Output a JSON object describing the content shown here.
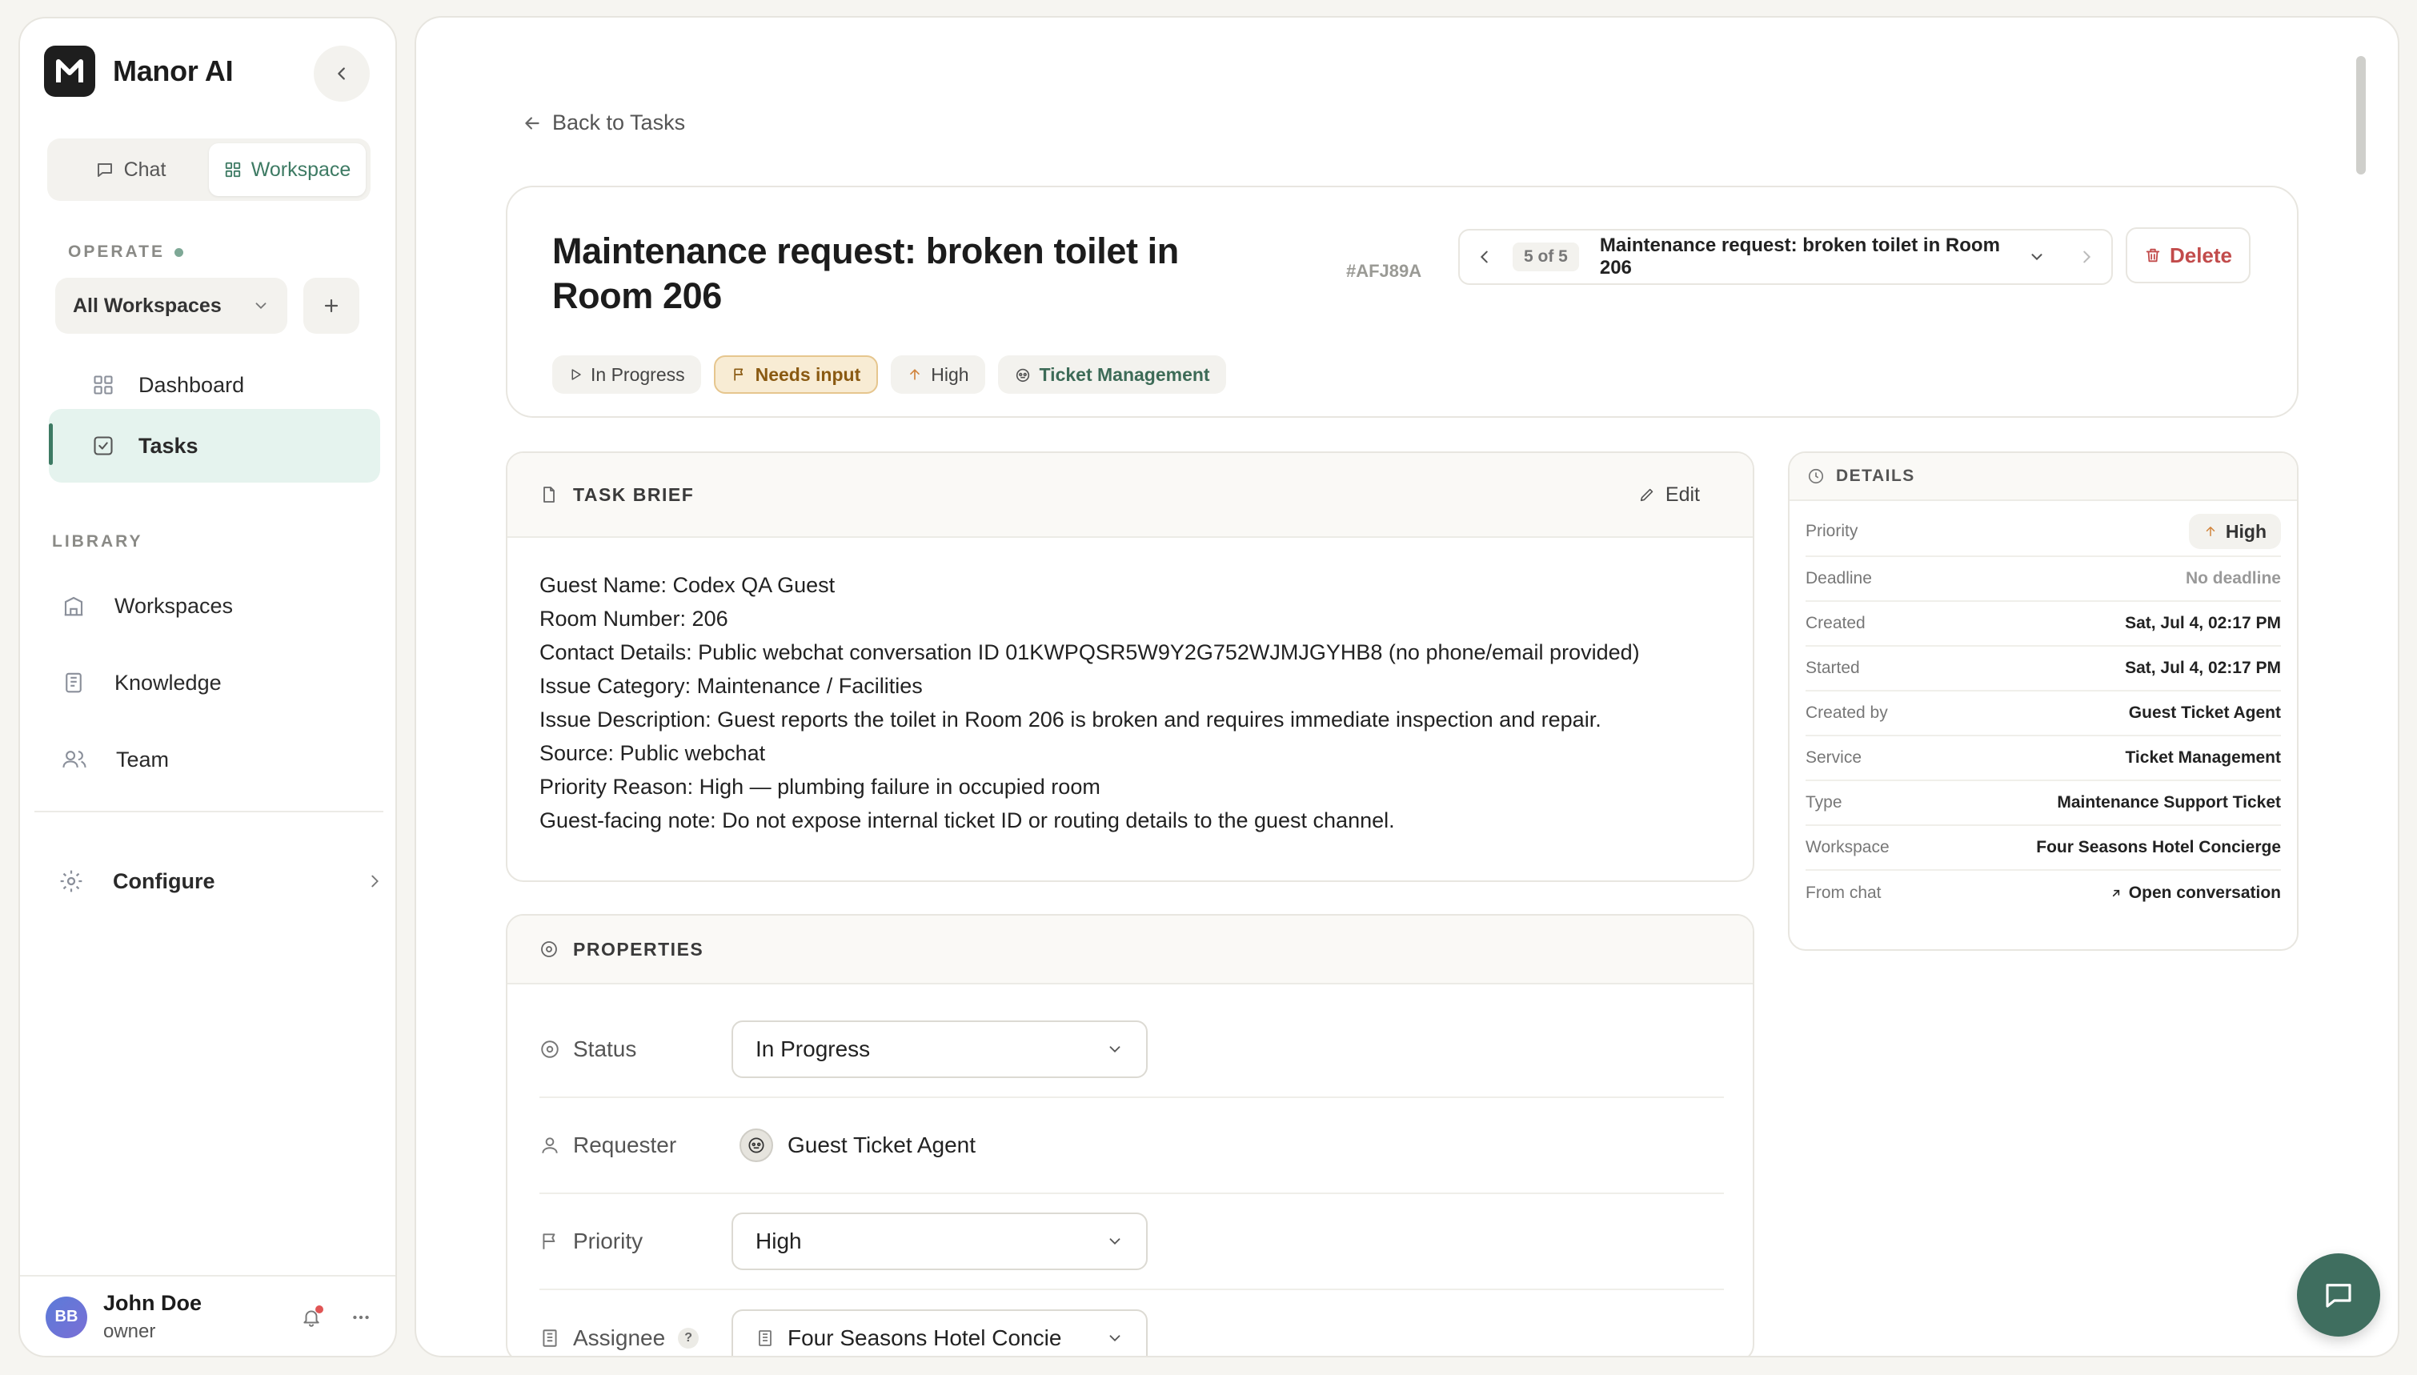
{
  "app": {
    "brand_name": "Manor AI",
    "accent_color": "#3d7a63"
  },
  "sidebar": {
    "modes": [
      {
        "label": "Chat",
        "icon": "chat-bubble-icon",
        "active": false
      },
      {
        "label": "Workspace",
        "icon": "grid-icon",
        "active": true
      }
    ],
    "operate_label": "OPERATE",
    "workspace_select": "All Workspaces",
    "nav": [
      {
        "label": "Dashboard",
        "icon": "dashboard-icon",
        "active": false
      },
      {
        "label": "Tasks",
        "icon": "checkbox-icon",
        "active": true
      }
    ],
    "library_label": "LIBRARY",
    "library": [
      {
        "label": "Workspaces",
        "icon": "building-icon"
      },
      {
        "label": "Knowledge",
        "icon": "book-icon"
      },
      {
        "label": "Team",
        "icon": "users-icon"
      }
    ],
    "configure_label": "Configure",
    "user": {
      "initials": "BB",
      "name": "John Doe",
      "role": "owner"
    }
  },
  "main": {
    "back_label": "Back to Tasks",
    "task": {
      "title": "Maintenance request: broken toilet in Room 206",
      "id": "#AFJ89A",
      "nav_count": "5 of 5",
      "nav_title": "Maintenance request: broken toilet in Room 206",
      "delete_label": "Delete",
      "badges": [
        {
          "label": "In Progress",
          "icon": "play-icon"
        },
        {
          "label": "Needs input",
          "icon": "flag-icon"
        },
        {
          "label": "High",
          "icon": "arrow-up-icon"
        },
        {
          "label": "Ticket Management",
          "icon": "service-icon"
        }
      ]
    },
    "brief": {
      "title": "TASK BRIEF",
      "edit_label": "Edit",
      "lines": [
        "Guest Name: Codex QA Guest",
        "Room Number: 206",
        "Contact Details: Public webchat conversation ID 01KWPQSR5W9Y2G752WJMJGYHB8 (no phone/email provided)",
        "Issue Category: Maintenance / Facilities",
        "Issue Description: Guest reports the toilet in Room 206 is broken and requires immediate inspection and repair.",
        "Source: Public webchat",
        "Priority Reason: High — plumbing failure in occupied room",
        "Guest-facing note: Do not expose internal ticket ID or routing details to the guest channel."
      ]
    },
    "properties": {
      "title": "PROPERTIES",
      "status_label": "Status",
      "status_value": "In Progress",
      "requester_label": "Requester",
      "requester_value": "Guest Ticket Agent",
      "priority_label": "Priority",
      "priority_value": "High",
      "assignee_label": "Assignee",
      "assignee_help": "?",
      "assignee_value": "Four Seasons Hotel Concie"
    },
    "details": {
      "title": "DETAILS",
      "rows": [
        {
          "label": "Priority",
          "value": "High"
        },
        {
          "label": "Deadline",
          "value": "No deadline"
        },
        {
          "label": "Created",
          "value": "Sat, Jul 4, 02:17 PM"
        },
        {
          "label": "Started",
          "value": "Sat, Jul 4, 02:17 PM"
        },
        {
          "label": "Created by",
          "value": "Guest Ticket Agent"
        },
        {
          "label": "Service",
          "value": "Ticket Management"
        },
        {
          "label": "Type",
          "value": "Maintenance Support Ticket"
        },
        {
          "label": "Workspace",
          "value": "Four Seasons Hotel Concierge"
        },
        {
          "label": "From chat",
          "value": "Open conversation"
        }
      ]
    }
  }
}
